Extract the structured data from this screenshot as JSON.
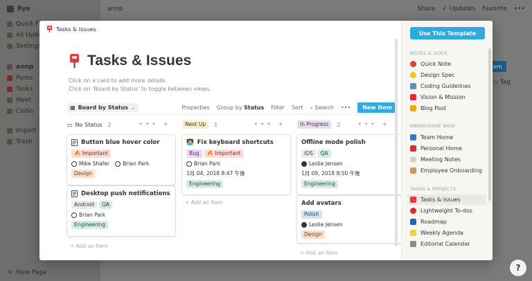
{
  "background": {
    "workspace": "Ryo",
    "sidebar_items": [
      "Quick Fi",
      "All Upda",
      "Settings",
      "annp",
      "Perso",
      "Tasks",
      "Meet",
      "Codin",
      "Import",
      "Trash",
      "New Page"
    ],
    "breadcrumb": "annp",
    "share": "Share",
    "updates": "Updates",
    "favorite": "Favorite",
    "blue_btn": "tem",
    "tag": "Tag",
    "help": "?"
  },
  "modal": {
    "header_title": "Tasks & Issues",
    "page_title": "Tasks & Issues",
    "desc1": "Click on a card to add more details.",
    "desc2": "Click on 'Board by Status' to toggle between views.",
    "toolbar": {
      "view": "Board by Status",
      "properties": "Properties",
      "group_by": "Group by",
      "group_by_value": "Status",
      "filter": "Filter",
      "sort": "Sort",
      "search": "Search",
      "more": "•••",
      "new_item": "New Item"
    },
    "columns": [
      {
        "name": "No Status",
        "count": "2",
        "plus": "••• +"
      },
      {
        "name": "Next Up",
        "count": "1",
        "plus": "••• +"
      },
      {
        "name": "In Progress",
        "count": "2",
        "plus": "••• +"
      }
    ],
    "cards": {
      "c1": {
        "title": "Button blue hover color",
        "tag1": "🔥 Important",
        "p1": "Mike Shafer",
        "p2": "Brian Park",
        "tag2": "Design"
      },
      "c2": {
        "title": "Desktop push notifications",
        "tag1": "Android",
        "tag2": "QA",
        "p1": "Brian Park",
        "tag3": "Engineering"
      },
      "c3": {
        "title": "Fix keyboard shortcuts",
        "tag1": "Bug",
        "tag2": "🔥 Important",
        "p1": "Brian Park",
        "date": "1月 04, 2018 8:47 午後",
        "tag3": "Engineering"
      },
      "c4": {
        "title": "Offline mode polish",
        "tag1": "iOS",
        "tag2": "QA",
        "p1": "Leslie Jensen",
        "date": "1月 09, 2018 8:50 午後",
        "tag3": "Engineering"
      },
      "c5": {
        "title": "Add avatars",
        "tag1": "Polish",
        "p1": "Leslie Jensen",
        "tag2": "Design"
      }
    },
    "add_item": "+ Add an Item"
  },
  "sidebar": {
    "use_template": "Use This Template",
    "sections": [
      {
        "title": "NOTES & DOCS",
        "items": [
          "Quick Note",
          "Design Spec",
          "Coding Guidelines",
          "Vision & Mission",
          "Blog Post"
        ]
      },
      {
        "title": "KNOWLEDGE BASE",
        "items": [
          "Team Home",
          "Personal Home",
          "Meeting Notes",
          "Employee Onboarding"
        ]
      },
      {
        "title": "TASKS & PROJECTS",
        "items": [
          "Tasks & Issues",
          "Lightweight To-dos",
          "Roadmap",
          "Weekly Agenda",
          "Editorial Calendar"
        ]
      }
    ]
  },
  "colors": {
    "accent": "#2eaadc",
    "red_tag": "#ffdcd9",
    "purple_tag": "#ead8f5",
    "gray_tag": "#ebeced",
    "teal_tag": "#d5ece9",
    "orange_tag": "#fbe0cd",
    "blue_tag": "#d3e5ef",
    "status_gray": "#e3e2e0",
    "status_yellow": "#fbeecc",
    "status_purple": "#e8def2"
  }
}
